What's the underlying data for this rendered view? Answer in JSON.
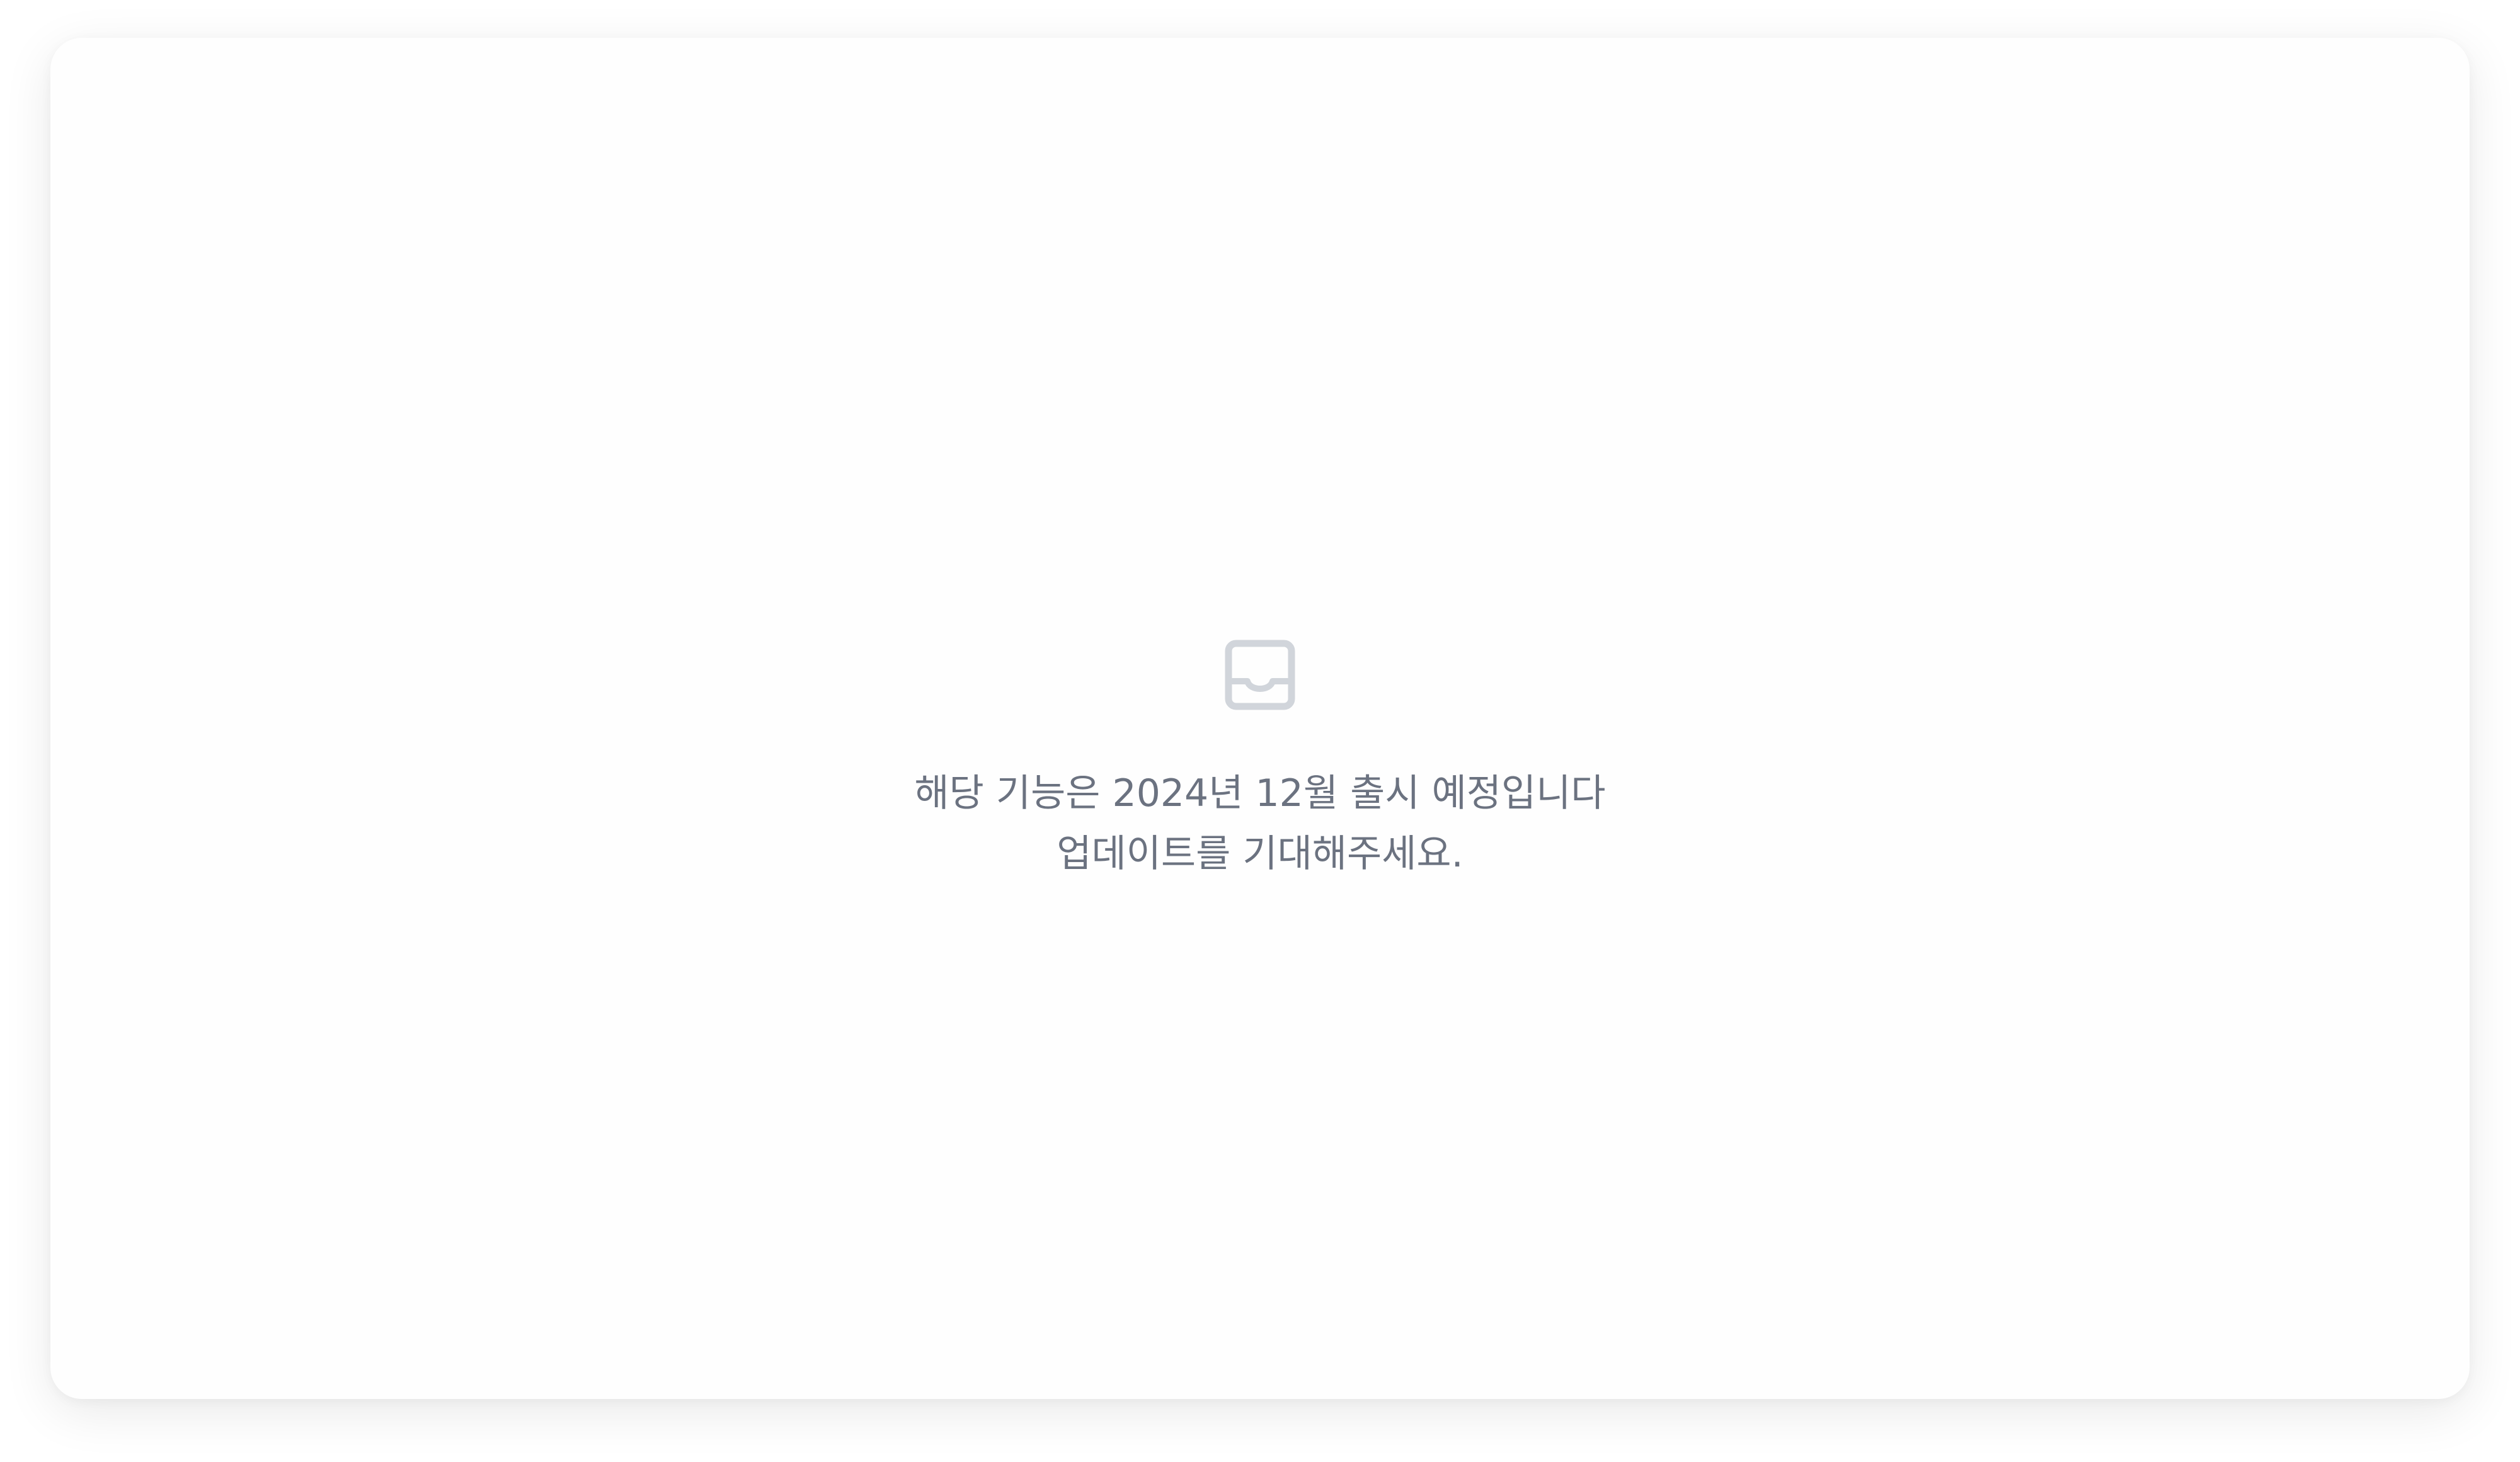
{
  "empty_state": {
    "icon": "inbox-tray-icon",
    "icon_color": "#d1d5db",
    "text_color": "#6b7280",
    "line1": "해당 기능은 2024년 12월 출시 예정입니다",
    "line2": "업데이트를 기대해주세요."
  }
}
